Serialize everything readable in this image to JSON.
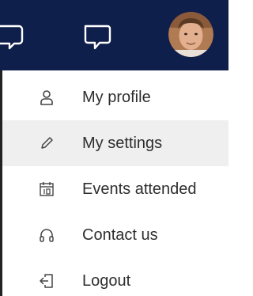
{
  "header": {
    "icons": [
      "comment-icon",
      "chat-icon"
    ],
    "avatar_icon": "user-avatar-photo"
  },
  "menu": {
    "items": [
      {
        "label": "My profile",
        "icon": "user-icon",
        "active": false
      },
      {
        "label": "My settings",
        "icon": "pencil-icon",
        "active": true
      },
      {
        "label": "Events attended",
        "icon": "calendar-icon",
        "active": false
      },
      {
        "label": "Contact us",
        "icon": "headset-icon",
        "active": false
      },
      {
        "label": "Logout",
        "icon": "logout-icon",
        "active": false
      }
    ]
  },
  "colors": {
    "header_bg": "#0f1f4b",
    "menu_bg": "#ffffff",
    "active_bg": "#efefef",
    "text": "#2e2e2e",
    "icon_stroke": "#444444"
  }
}
